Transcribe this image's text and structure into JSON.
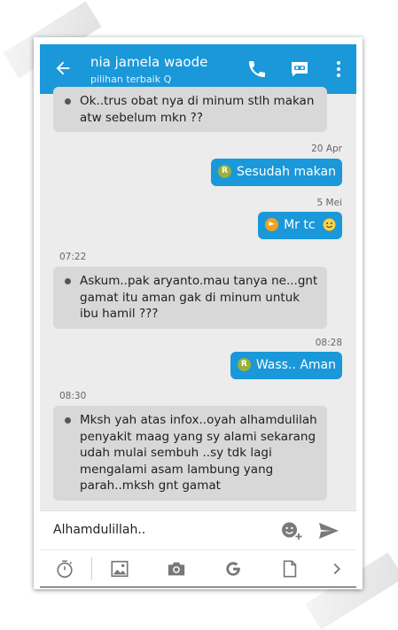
{
  "header": {
    "contact_name": "nia jamela waode",
    "subtitle": "pilihan terbaik Q",
    "bar_color": "#1a98d9",
    "icons": [
      "back-arrow-icon",
      "phone-icon",
      "video-chat-icon",
      "more-vert-icon"
    ]
  },
  "messages": [
    {
      "direction": "in",
      "text": "Ok..trus obat nya di minum stlh makan atw sebelum mkn ??"
    },
    {
      "direction": "timestamp",
      "text": "20 Apr"
    },
    {
      "direction": "out",
      "badge": "R",
      "text": "Sesudah makan"
    },
    {
      "direction": "timestamp",
      "text": "5 Mei"
    },
    {
      "direction": "out",
      "badge": "sticker",
      "text": "Mr tc"
    },
    {
      "direction": "timestamp",
      "text": "07:22"
    },
    {
      "direction": "in",
      "text": "Askum..pak aryanto.mau tanya ne...gnt gamat itu aman gak di minum untuk ibu hamil ???"
    },
    {
      "direction": "timestamp",
      "text": "08:28"
    },
    {
      "direction": "out",
      "badge": "R",
      "text": "Wass.. Aman"
    },
    {
      "direction": "timestamp",
      "text": "08:30"
    },
    {
      "direction": "in",
      "text": "Mksh yah atas infox..oyah alhamdulilah penyakit maag yang sy alami sekarang udah mulai sembuh ..sy tdk lagi mengalami asam lambung yang parah..mksh gnt gamat"
    }
  ],
  "composer": {
    "text": "Alhamdulillah..",
    "icons": [
      "emoji-add-icon",
      "send-icon"
    ]
  },
  "toolbar": {
    "icons": [
      "timer-icon",
      "image-icon",
      "camera-icon",
      "google-icon",
      "document-icon",
      "chevron-right-icon"
    ]
  }
}
